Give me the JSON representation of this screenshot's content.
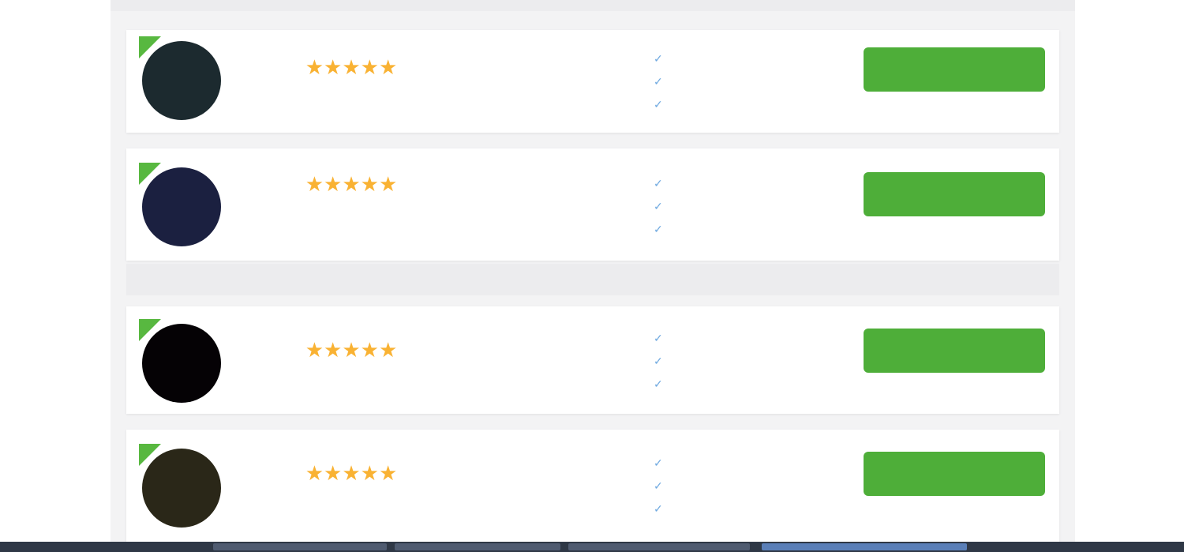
{
  "colors": {
    "accent": "#4eae39",
    "link": "#6fa9e0",
    "star": "#f9b233",
    "bonus": "#3c4a8c"
  },
  "listings": [
    {
      "logo_icon": "teal-logo-icon",
      "logo_bg": "#1c2a2f",
      "logo_text": "",
      "logo_color": "#3fa890",
      "name": "",
      "stars": "★★★★★",
      "rating_text": "",
      "bonus_label": "",
      "bonus_value": "",
      "bonus_sub": "",
      "features": [
        "",
        "",
        ""
      ],
      "cta_label": "",
      "review_link": ""
    },
    {
      "logo_icon": "navy-logo-icon",
      "logo_bg": "#1b2040",
      "logo_text": "",
      "logo_color": "#8a93c8",
      "name": "",
      "stars": "★★★★★",
      "rating_text": "",
      "bonus_label": "",
      "bonus_value": "",
      "bonus_sub": "",
      "features": [
        "",
        "",
        ""
      ],
      "cta_label": "",
      "review_link": ""
    },
    {
      "logo_icon": "magenta-logo-icon",
      "logo_bg": "#050205",
      "logo_text": "",
      "logo_color": "#c2185b",
      "name": "",
      "stars": "★★★★★",
      "rating_text": "",
      "bonus_label": "",
      "bonus_value": "",
      "bonus_sub": "",
      "features": [
        "",
        "",
        ""
      ],
      "cta_label": "",
      "review_link": ""
    },
    {
      "logo_icon": "gold-logo-icon",
      "logo_bg": "#2a2718",
      "logo_text": "",
      "logo_color": "#d9b63a",
      "name": "",
      "stars": "★★★★★",
      "rating_text": "",
      "bonus_label": "",
      "bonus_value": "",
      "bonus_sub": "",
      "features": [
        "",
        "",
        ""
      ],
      "cta_label": "",
      "review_link": ""
    }
  ],
  "ad_note": ""
}
